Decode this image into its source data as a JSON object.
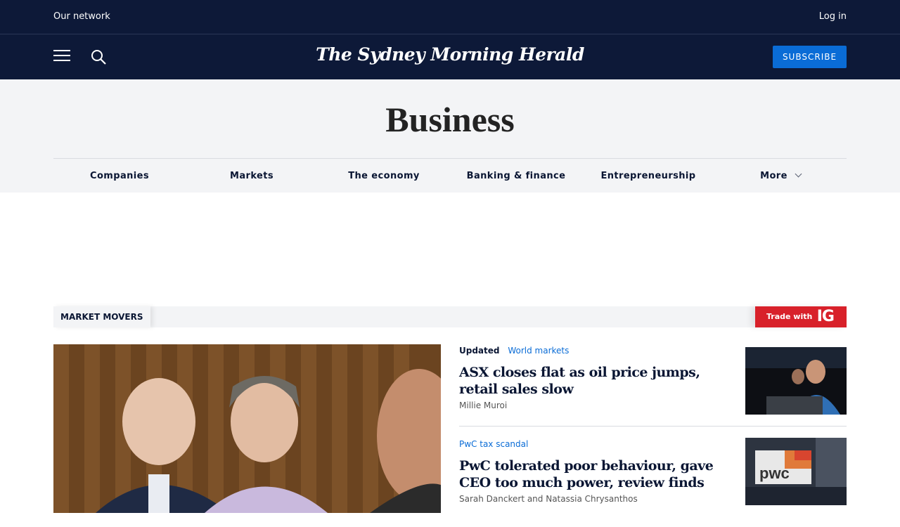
{
  "header": {
    "network_label": "Our network",
    "login_label": "Log in",
    "masthead": "The Sydney Morning Herald",
    "subscribe_label": "SUBSCRIBE",
    "menu_icon": "hamburger-menu-icon",
    "search_icon": "search-icon"
  },
  "section": {
    "title": "Business",
    "nav": [
      "Companies",
      "Markets",
      "The economy",
      "Banking & finance",
      "Entrepreneurship",
      "More"
    ]
  },
  "market_movers": {
    "label": "MARKET MOVERS",
    "sponsor_text": "Trade with",
    "sponsor_logo": "IG"
  },
  "stories": [
    {
      "status": "Updated",
      "tag": "World markets",
      "headline": "ASX closes flat as oil price jumps, retail sales slow",
      "byline": "Millie Muroi"
    },
    {
      "status": "",
      "tag": "PwC tax scandal",
      "headline": "PwC tolerated poor behaviour, gave CEO too much power, review finds",
      "byline": "Sarah Danckert and Natassia Chrysanthos"
    }
  ],
  "colors": {
    "nav_bg": "#0d1938",
    "accent": "#0a6cd6",
    "sponsor_red": "#d8212a",
    "section_bg": "#f3f4f6"
  }
}
